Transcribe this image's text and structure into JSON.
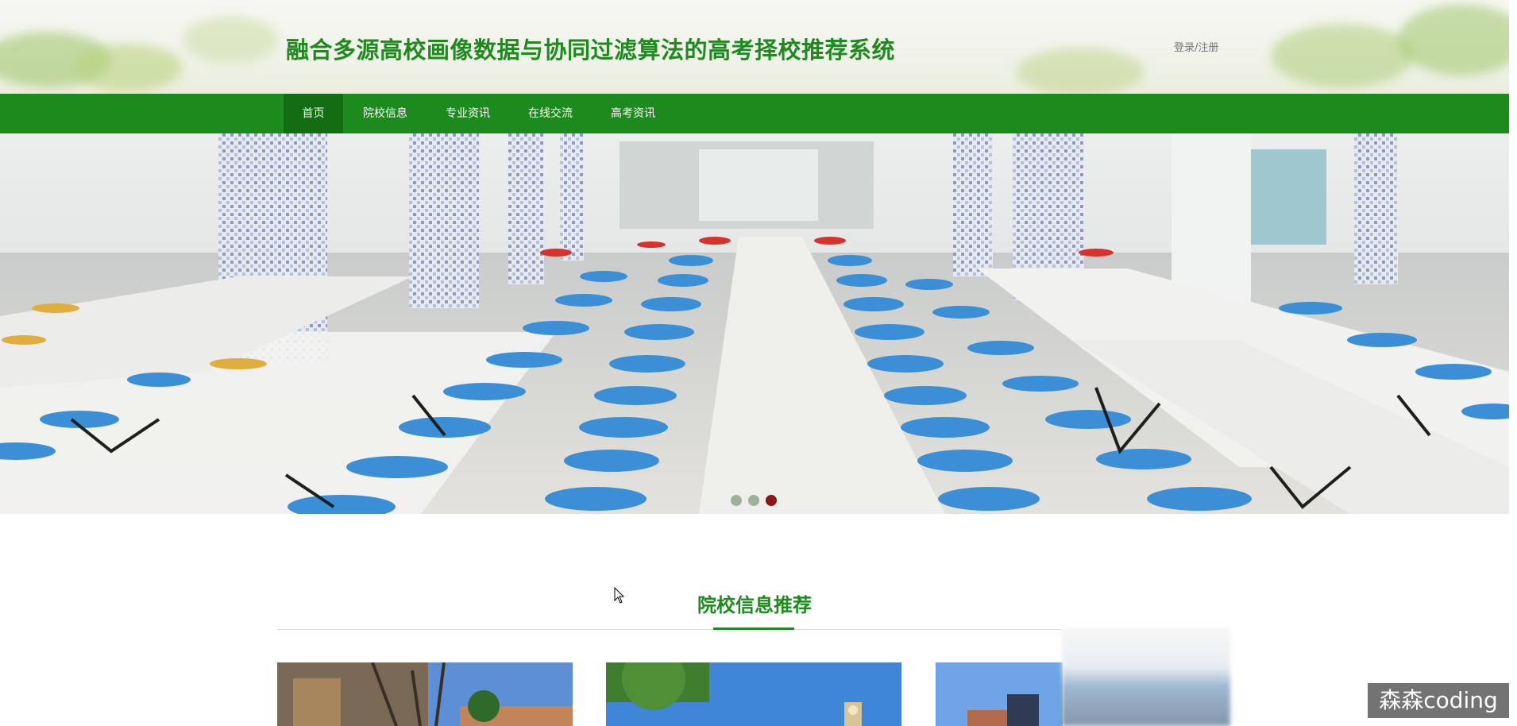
{
  "header": {
    "title": "融合多源高校画像数据与协同过滤算法的高考择校推荐系统",
    "login_label": "登录/注册"
  },
  "nav": {
    "items": [
      {
        "label": "首页",
        "active": true
      },
      {
        "label": "院校信息",
        "active": false
      },
      {
        "label": "专业资讯",
        "active": false
      },
      {
        "label": "在线交流",
        "active": false
      },
      {
        "label": "高考资讯",
        "active": false
      }
    ]
  },
  "banner": {
    "image": "cafeteria-photo",
    "slide_count": 3,
    "active_slide": 3
  },
  "recommend": {
    "title": "院校信息推荐",
    "cards": [
      "campus-photo-1",
      "campus-photo-2",
      "campus-photo-3"
    ]
  },
  "watermark": "森森coding",
  "colors": {
    "brand_green": "#1f8a1f",
    "nav_green": "#1c8a1c",
    "nav_active": "#136e13",
    "dot_active": "#8c1616",
    "dot_inactive": "#9fb09c"
  }
}
